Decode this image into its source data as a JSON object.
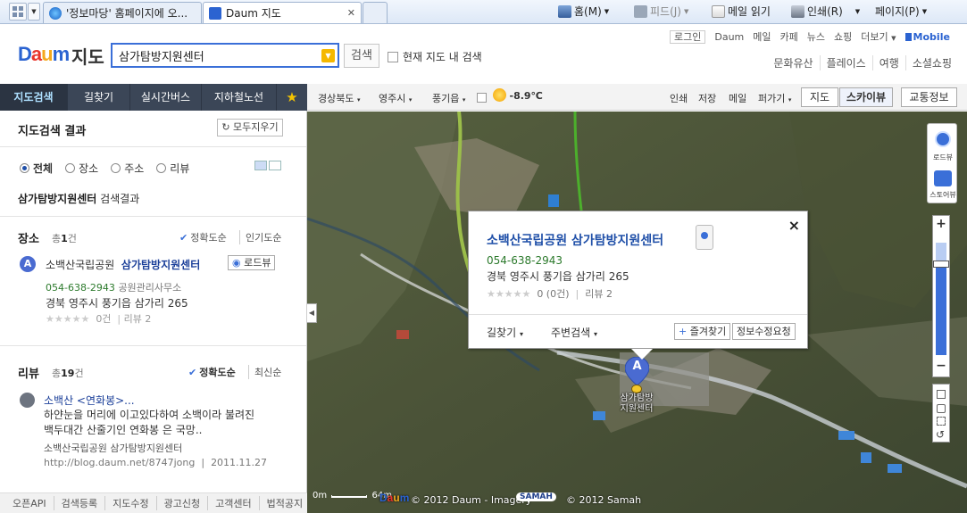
{
  "browser": {
    "tabs": [
      {
        "label": "'정보마당' 홈페이지에 오..."
      },
      {
        "label": "Daum 지도"
      }
    ],
    "toolbar": {
      "home": "홈(M)",
      "feed": "피드(J)",
      "mail": "메일 읽기",
      "print": "인쇄(R)",
      "page": "페이지(P)"
    }
  },
  "header": {
    "logo": "Daum",
    "service": "지도",
    "search_value": "삼가탐방지원센터",
    "search_button": "검색",
    "current_map_search": "현재 지도 내 검색",
    "gnb": [
      "로그인",
      "Daum",
      "메일",
      "카페",
      "뉴스",
      "쇼핑",
      "더보기",
      "Mobile"
    ],
    "sublinks": [
      "문화유산",
      "플레이스",
      "여행",
      "소셜쇼핑"
    ]
  },
  "nav": {
    "items": [
      "지도검색",
      "길찾기",
      "실시간버스",
      "지하철노선"
    ],
    "star": "★"
  },
  "map_toolbar": {
    "region": [
      "경상북도",
      "영주시",
      "풍기읍"
    ],
    "weather": "-8.9℃",
    "actions": [
      "인쇄",
      "저장",
      "메일",
      "퍼가기"
    ],
    "view_map": "지도",
    "view_sky": "스카이뷰",
    "traffic": "교통정보"
  },
  "results": {
    "title": "지도검색 결과",
    "clear_all": "모두지우기",
    "filters": [
      "전체",
      "장소",
      "주소",
      "리뷰"
    ],
    "query": "삼가탐방지원센터",
    "query_suffix": "검색결과",
    "place": {
      "section": "장소",
      "count_prefix": "총",
      "count": "1",
      "count_suffix": "건",
      "sort_accuracy": "정확도순",
      "sort_popular": "인기도순",
      "pin": "A",
      "park": "소백산국립공원",
      "name": "삼가탐방지원센터",
      "roadview": "로드뷰",
      "tel": "054-638-2943",
      "category": "공원관리사무소",
      "address": "경북 영주시 풍기읍 삼가리 265",
      "stars": "★★★★★",
      "rating_count": "0건",
      "review_count": "리뷰 2"
    },
    "review": {
      "section": "리뷰",
      "count_prefix": "총",
      "count": "19",
      "count_suffix": "건",
      "sort_accuracy": "정확도순",
      "sort_latest": "최신순",
      "title": "소백산 <연화봉>...",
      "line1": "하얀눈을 머리에 이고있다하여 소백이라 불려진",
      "line2": "백두대간 산줄기인 연화봉 은 국망..",
      "source": "소백산국립공원 삼가탐방지원센터",
      "url": "http://blog.daum.net/8747jong",
      "date": "2011.11.27"
    }
  },
  "footer": [
    "오픈API",
    "검색등록",
    "지도수정",
    "광고신청",
    "고객센터",
    "법적공지"
  ],
  "infowindow": {
    "title": "소백산국립공원 삼가탐방지원센터",
    "close": "×",
    "tel": "054-638-2943",
    "address": "경북 영주시 풍기읍 삼가리 265",
    "stars": "★★★★★",
    "rating": "0 (0건)",
    "reviews": "리뷰 2",
    "route": "길찾기",
    "nearby": "주변검색",
    "favorite": "즐겨찾기",
    "edit": "정보수정요청"
  },
  "map": {
    "marker": "A",
    "marker_label_1": "삼가탐방",
    "marker_label_2": "지원센터",
    "roadview_label": "로드뷰",
    "storeview_label": "스토어뷰",
    "zoom_in": "+",
    "zoom_out": "−",
    "scale_start": "0m",
    "scale_end": "64m",
    "copyright": "© 2012 Daum - Imagery",
    "samah": "© 2012 Samah",
    "samah_logo": "SAMAH"
  },
  "colors": {
    "accent": "#3a6fd8",
    "nav_bg": "#3b4657",
    "link": "#1f4fa8",
    "tel": "#2c7a2c"
  }
}
